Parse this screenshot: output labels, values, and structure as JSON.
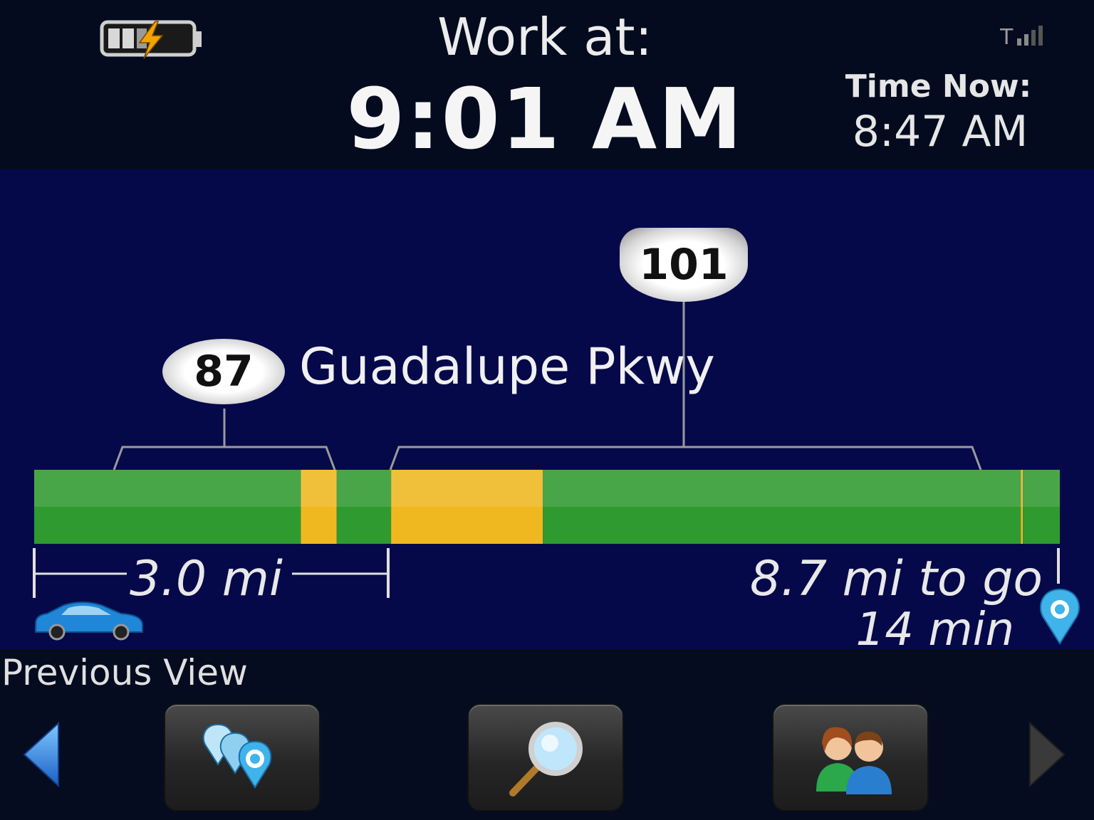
{
  "header": {
    "work_label": "Work at:",
    "work_time": "9:01 AM",
    "now_label": "Time Now:",
    "now_time": "8:47 AM",
    "battery_icon": "battery-charging-icon",
    "signal_icon": "signal-strength-icon"
  },
  "route": {
    "shield_87": "87",
    "shield_101": "101",
    "road_name": "Guadalupe Pkwy",
    "segment_distance": "3.0 mi",
    "remaining_distance": "8.7 mi to go",
    "eta": "14 min",
    "traffic_colors": {
      "free_flow": "#2f9a2f",
      "slow": "#f0b820"
    },
    "traffic_segments": [
      {
        "status": "free_flow",
        "from": 0.0,
        "to": 0.26
      },
      {
        "status": "slow",
        "from": 0.26,
        "to": 0.295
      },
      {
        "status": "free_flow",
        "from": 0.295,
        "to": 0.348
      },
      {
        "status": "slow",
        "from": 0.348,
        "to": 0.496
      },
      {
        "status": "free_flow",
        "from": 0.496,
        "to": 0.962
      },
      {
        "status": "slow",
        "from": 0.962,
        "to": 0.964
      },
      {
        "status": "free_flow",
        "from": 0.964,
        "to": 1.0
      }
    ]
  },
  "footer": {
    "previous_view_label": "Previous View",
    "buttons": [
      "locations-icon",
      "search-icon",
      "contacts-icon"
    ]
  }
}
